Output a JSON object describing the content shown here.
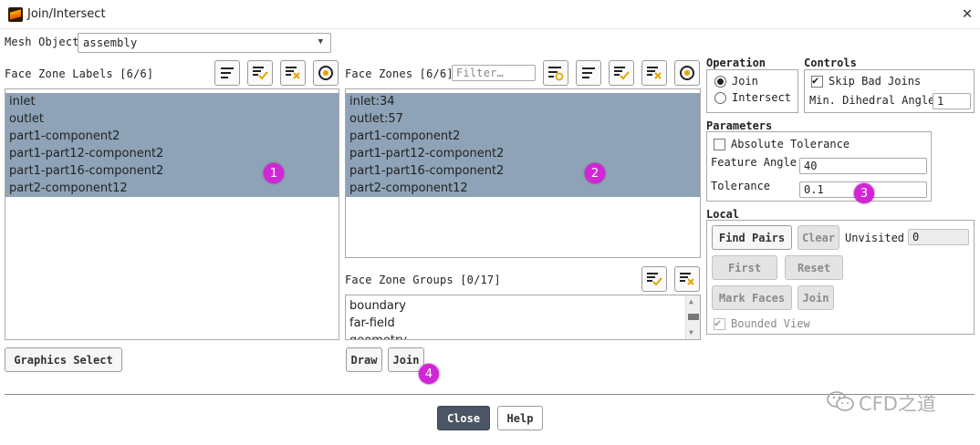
{
  "window": {
    "title": "Join/Intersect"
  },
  "mesh_object": {
    "label": "Mesh Object",
    "value": "assembly"
  },
  "face_zone_labels": {
    "header": "Face Zone Labels [6/6]",
    "items": [
      "inlet",
      "outlet",
      "part1-component2",
      "part1-part12-component2",
      "part1-part16-component2",
      "part2-component12"
    ],
    "selected_all": true
  },
  "face_zones": {
    "header": "Face Zones [6/6]",
    "filter_placeholder": "Filter…",
    "items": [
      "inlet:34",
      "outlet:57",
      "part1-component2",
      "part1-part12-component2",
      "part1-part16-component2",
      "part2-component12"
    ]
  },
  "face_zone_groups": {
    "header": "Face Zone Groups [0/17]",
    "items": [
      "boundary",
      "far-field",
      "geometry"
    ]
  },
  "buttons": {
    "graphics_select": "Graphics Select",
    "draw": "Draw",
    "join": "Join",
    "close": "Close",
    "help": "Help"
  },
  "operation": {
    "title": "Operation",
    "join": "Join",
    "intersect": "Intersect",
    "selected": "Join"
  },
  "controls": {
    "title": "Controls",
    "skip_bad_joins": "Skip Bad Joins",
    "skip_checked": true,
    "min_dihedral_label": "Min. Dihedral Angle",
    "min_dihedral_value": "1"
  },
  "parameters": {
    "title": "Parameters",
    "absolute_tolerance": "Absolute Tolerance",
    "abs_checked": false,
    "feature_angle_label": "Feature Angle",
    "feature_angle_value": "40",
    "tolerance_label": "Tolerance",
    "tolerance_value": "0.1"
  },
  "local": {
    "title": "Local",
    "find_pairs": "Find Pairs",
    "clear": "Clear",
    "unvisited_label": "Unvisited",
    "unvisited_value": "0",
    "first": "First",
    "reset": "Reset",
    "mark_faces": "Mark Faces",
    "join": "Join",
    "bounded_view": "Bounded View",
    "bounded_checked": true
  },
  "badges": [
    "1",
    "2",
    "3",
    "4"
  ],
  "watermark": "CFD之道",
  "colors": {
    "selection": "#8ea3b7",
    "badge": "#d325d8",
    "check_accent": "#e2a400",
    "x_accent": "#e2a400"
  }
}
